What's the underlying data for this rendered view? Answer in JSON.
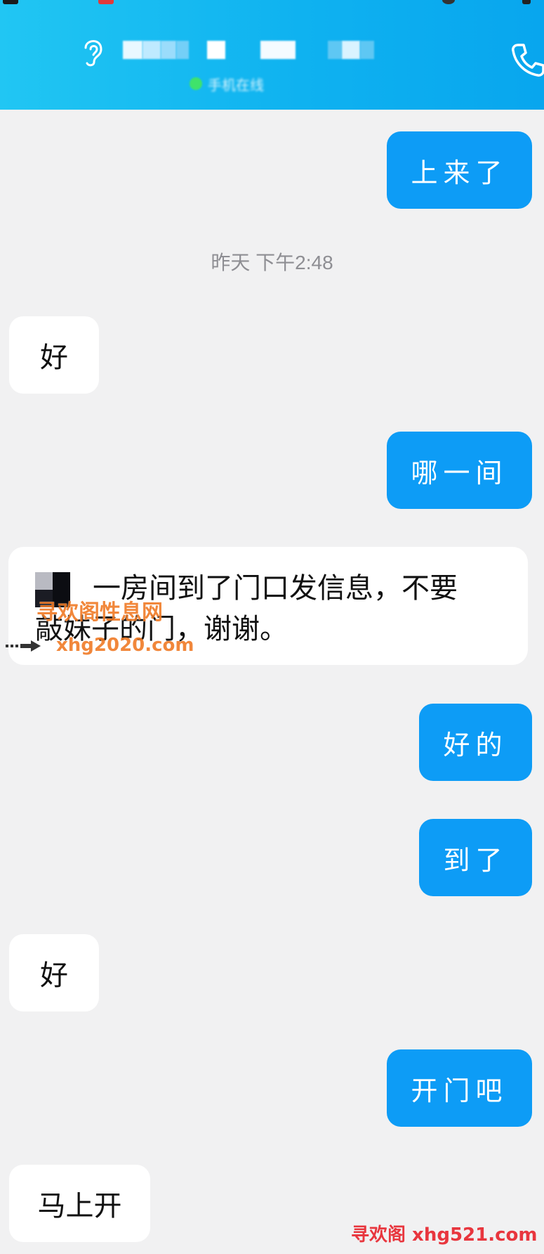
{
  "header": {
    "status": "手机在线",
    "contact_name_redacted": true
  },
  "messages": [
    {
      "side": "out",
      "text": "上来了"
    },
    {
      "side": "time",
      "text": "昨天 下午2:48"
    },
    {
      "side": "in",
      "text": "好"
    },
    {
      "side": "out",
      "text": "哪一间"
    },
    {
      "side": "in",
      "line1": "一房间到了门口发信息，不要",
      "line2": "敲妹子的门，谢谢。"
    },
    {
      "side": "out",
      "text": "好的"
    },
    {
      "side": "out",
      "text": "到了"
    },
    {
      "side": "in",
      "text": "好"
    },
    {
      "side": "out",
      "text": "开门吧"
    },
    {
      "side": "in",
      "text": "马上开"
    }
  ],
  "watermarks": {
    "top_cn": "寻欢阁性息网",
    "top_url": "xhg2020.com",
    "bottom": "寻欢阁 xhg521.com"
  },
  "colors": {
    "header_gradient_start": "#21c6f3",
    "header_gradient_end": "#08a6ee",
    "outgoing_bubble": "#0d9cf6",
    "incoming_bubble": "#ffffff",
    "background": "#f1f1f2",
    "watermark_orange": "#f07b26",
    "watermark_red": "#e8363e"
  }
}
